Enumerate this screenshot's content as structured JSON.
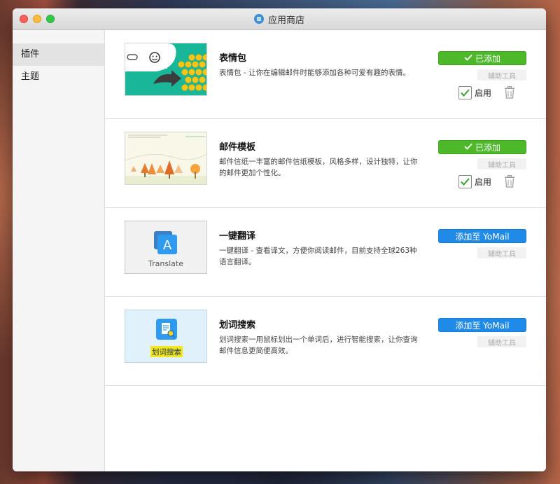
{
  "window": {
    "title": "应用商店"
  },
  "sidebar": {
    "items": [
      {
        "label": "插件"
      },
      {
        "label": "主题"
      }
    ]
  },
  "plugins": [
    {
      "name": "表情包",
      "description": "表情包 - 让你在编辑邮件时能够添加各种可爱有趣的表情。",
      "action_label": "已添加",
      "tag": "辅助工具",
      "enable_label": "启用"
    },
    {
      "name": "邮件模板",
      "description": "邮件信纸一丰富的邮件信纸模板，风格多样，设计独特，让你的邮件更加个性化。",
      "action_label": "已添加",
      "tag": "辅助工具",
      "enable_label": "启用"
    },
    {
      "name": "一键翻译",
      "description": "一键翻译 - 查看译文，方便你阅读邮件，目前支持全球263种语言翻译。",
      "action_label": "添加至 YoMail",
      "tag": "辅助工具",
      "thumb_label": "Translate"
    },
    {
      "name": "划词搜索",
      "description": "划词搜索一用鼠标划出一个单词后，进行智能搜索，让你查询邮件信息更简便高效。",
      "action_label": "添加至 YoMail",
      "tag": "辅助工具",
      "thumb_label": "划词搜索"
    }
  ],
  "colors": {
    "added": "#4cb82a",
    "add": "#1f8ae8",
    "emoji_bg": "#19b79a"
  }
}
